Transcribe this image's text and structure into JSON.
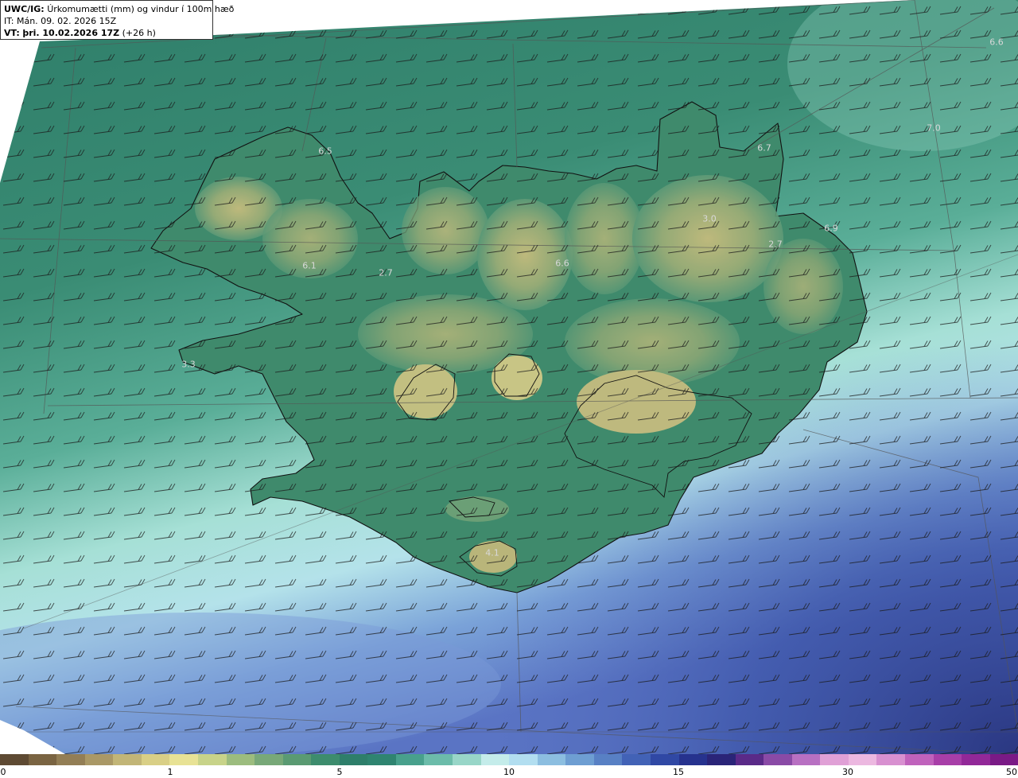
{
  "header": {
    "model": "UWC/IG:",
    "field_desc": "Úrkomumætti (mm) og vindur í 100m hæð",
    "init_prefix": "IT:",
    "init_time": "Mán. 09. 02. 2026 15Z",
    "valid_prefix": "VT:",
    "valid_time": "þri. 10.02.2026 17Z",
    "lead": "(+26 h)"
  },
  "map_labels": [
    "6.6",
    "6.5",
    "7.0",
    "6.7",
    "6.9",
    "3.0",
    "2.7",
    "6.1",
    "2.7",
    "6.6",
    "3.3",
    "4.1"
  ],
  "colorbar": {
    "ticks": [
      "0",
      "1",
      "5",
      "10",
      "15",
      "30",
      "50"
    ],
    "segments": [
      "#5e4a33",
      "#7a6442",
      "#937e55",
      "#aa9866",
      "#c2b577",
      "#d9cf86",
      "#e8e295",
      "#c8d389",
      "#9cbc7e",
      "#78a878",
      "#5a9a72",
      "#3d8c6d",
      "#2e7e6a",
      "#2f8470",
      "#48a08c",
      "#6cbcaa",
      "#98d6c8",
      "#c4ecea",
      "#b2def0",
      "#8cbee0",
      "#6e9ed2",
      "#5880c4",
      "#4262b6",
      "#3048a4",
      "#26328e",
      "#2a2478",
      "#5a2a88",
      "#8a4aa6",
      "#b870c2",
      "#e0a0d6",
      "#ecb8e0",
      "#d890d0",
      "#c062bc",
      "#a83ea8",
      "#922898",
      "#7a1a86"
    ]
  },
  "colors": {
    "land_low": "#3f8a6c",
    "land_high": "#c9bc7c",
    "sea_north": "#2f7e6a",
    "sea_mid": "#7ec6b8",
    "sea_light": "#c6ecec",
    "sea_blue": "#5c7cc8",
    "sea_deep": "#2c3a8c"
  }
}
